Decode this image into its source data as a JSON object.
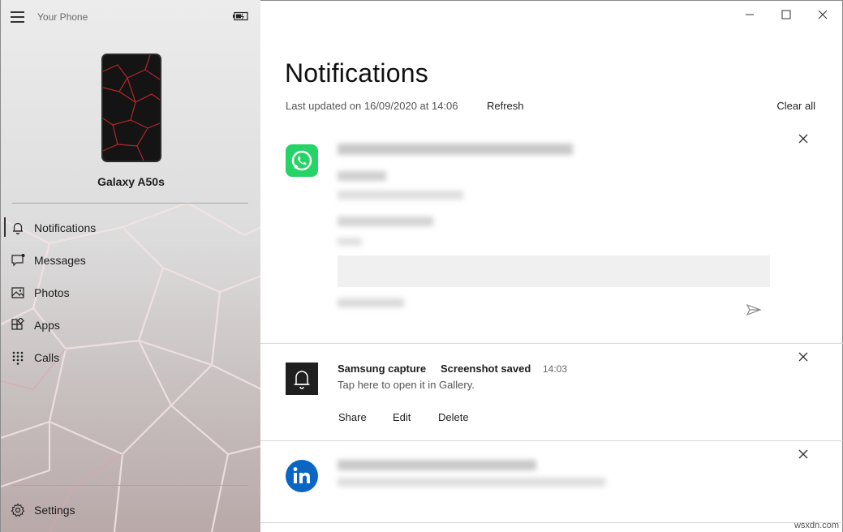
{
  "app": {
    "title": "Your Phone",
    "device_name": "Galaxy A50s"
  },
  "nav": {
    "items": [
      {
        "label": "Notifications",
        "icon": "bell-icon",
        "active": true
      },
      {
        "label": "Messages",
        "icon": "chat-icon",
        "active": false
      },
      {
        "label": "Photos",
        "icon": "photo-icon",
        "active": false
      },
      {
        "label": "Apps",
        "icon": "apps-icon",
        "active": false
      },
      {
        "label": "Calls",
        "icon": "dialpad-icon",
        "active": false
      }
    ],
    "settings_label": "Settings"
  },
  "main": {
    "title": "Notifications",
    "last_updated": "Last updated on 16/09/2020 at 14:06",
    "refresh_label": "Refresh",
    "clear_all_label": "Clear all"
  },
  "notifications": [
    {
      "app": "WhatsApp",
      "icon": "whatsapp-icon",
      "blurred": true,
      "icon_color": "#25D366"
    },
    {
      "app": "Samsung capture",
      "title": "Screenshot saved",
      "time": "14:03",
      "body": "Tap here to open it in Gallery.",
      "icon": "bell-icon",
      "actions": [
        "Share",
        "Edit",
        "Delete"
      ],
      "icon_color": "#1f1f1f"
    },
    {
      "app": "LinkedIn",
      "icon": "linkedin-icon",
      "blurred": true,
      "icon_color": "#0A66C2"
    }
  ],
  "watermark": "wsxdn.com",
  "colors": {
    "sidebar_bg": "#dcdcdc",
    "accent_whatsapp": "#25D366",
    "accent_linkedin": "#0A66C2"
  }
}
